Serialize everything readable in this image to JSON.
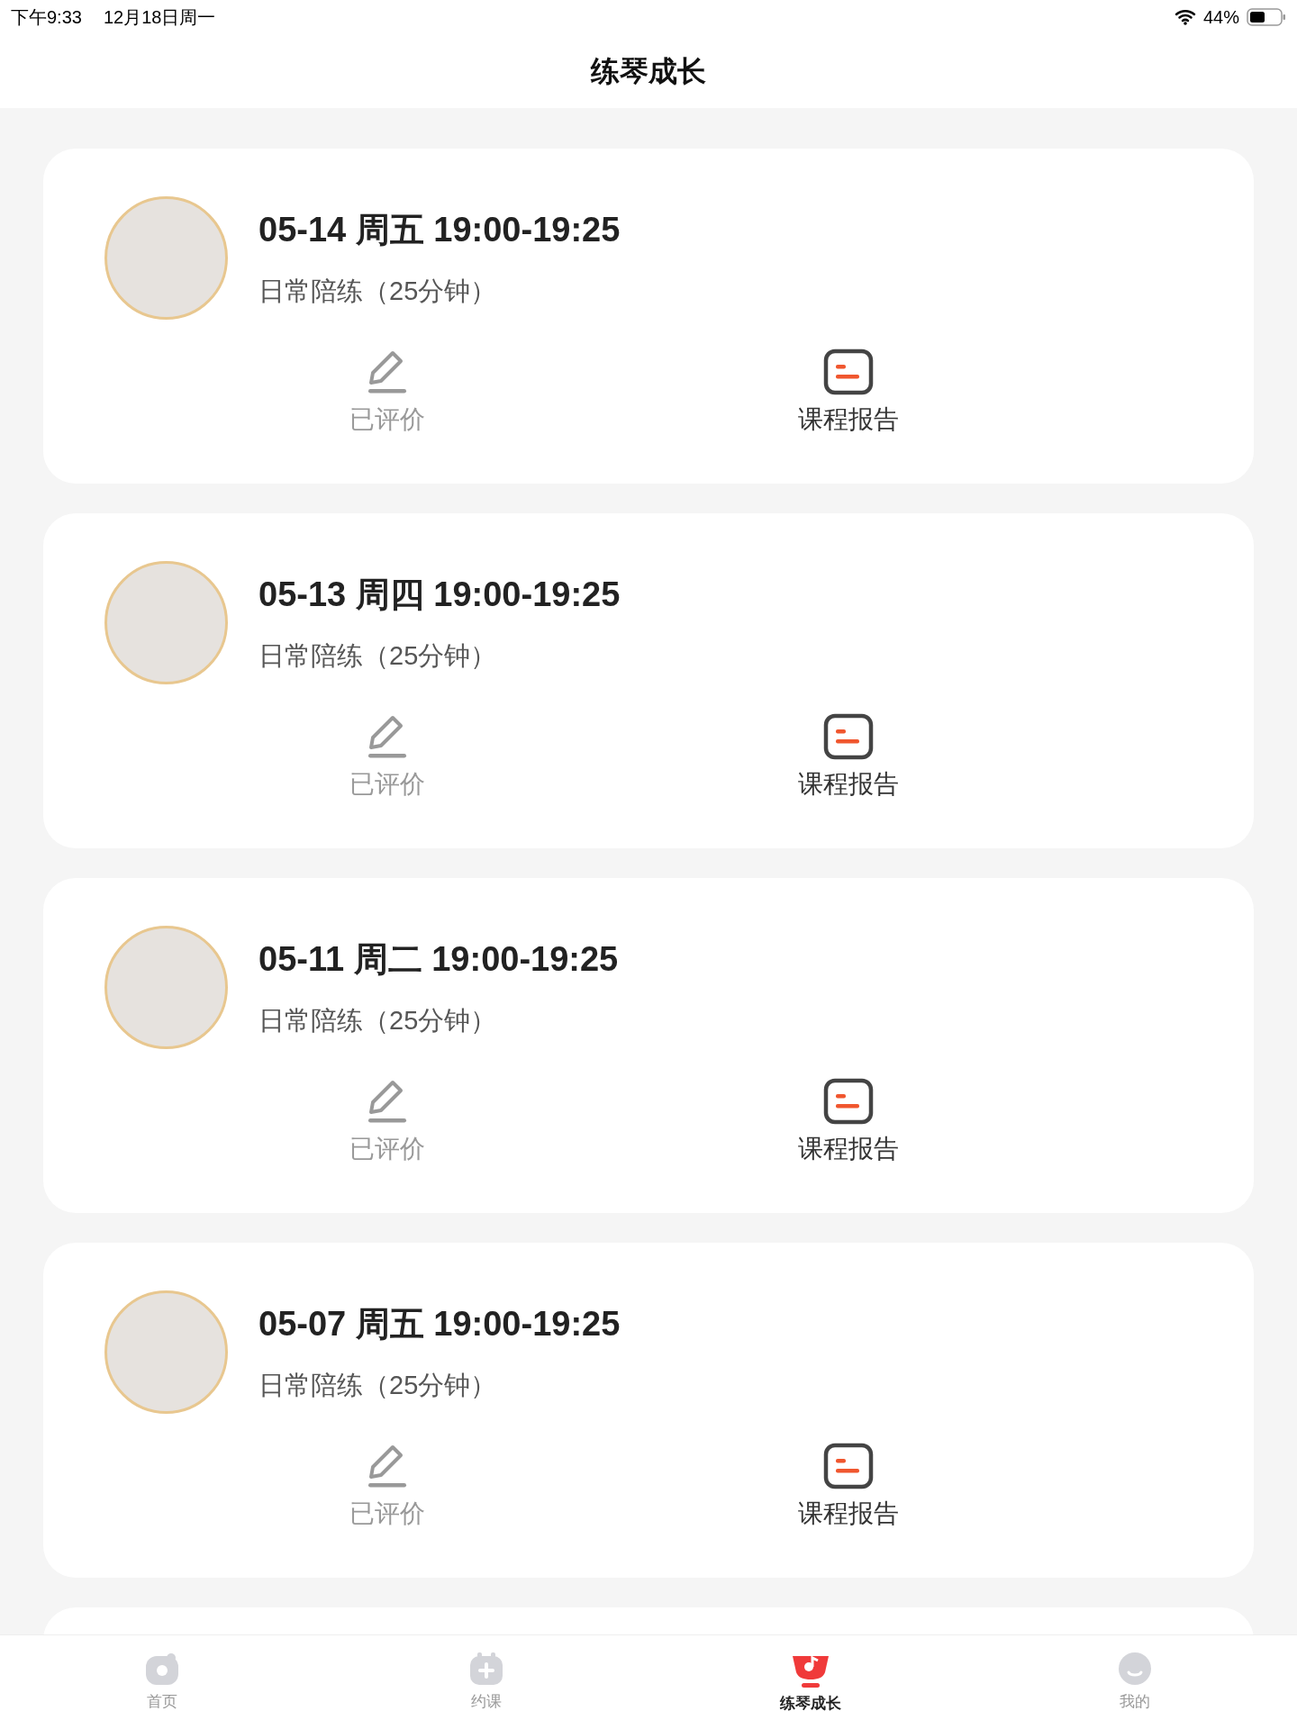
{
  "status_bar": {
    "time": "下午9:33",
    "date": "12月18日周一",
    "battery": "44%"
  },
  "nav": {
    "title": "练琴成长"
  },
  "lessons": [
    {
      "time": "05-14 周五 19:00-19:25",
      "type": "日常陪练（25分钟）",
      "review": {
        "label": "已评价",
        "done": true
      },
      "report": "课程报告"
    },
    {
      "time": "05-13 周四 19:00-19:25",
      "type": "日常陪练（25分钟）",
      "review": {
        "label": "已评价",
        "done": true
      },
      "report": "课程报告"
    },
    {
      "time": "05-11 周二 19:00-19:25",
      "type": "日常陪练（25分钟）",
      "review": {
        "label": "已评价",
        "done": true
      },
      "report": "课程报告"
    },
    {
      "time": "05-07 周五 19:00-19:25",
      "type": "日常陪练（25分钟）",
      "review": {
        "label": "已评价",
        "done": true
      },
      "report": "课程报告"
    }
  ],
  "tab_bar": [
    {
      "label": "首页",
      "kind": "home",
      "selected": false
    },
    {
      "label": "约课",
      "kind": "book",
      "selected": false
    },
    {
      "label": "练琴成长",
      "kind": "growth",
      "selected": true
    },
    {
      "label": "我的",
      "kind": "me",
      "selected": false
    }
  ]
}
